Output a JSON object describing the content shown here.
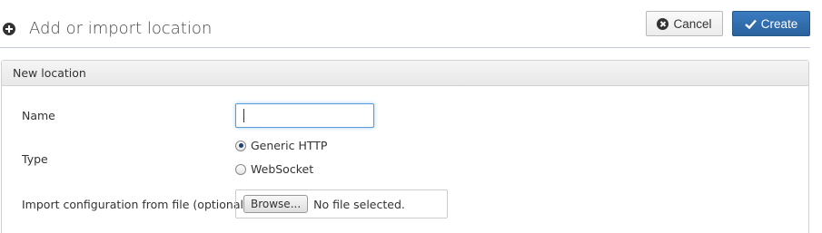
{
  "header": {
    "title": "Add or import location",
    "icon": "plus-circle-icon"
  },
  "actions": {
    "cancel_label": "Cancel",
    "create_label": "Create",
    "create_color": "#2f6aa8"
  },
  "panel": {
    "heading": "New location"
  },
  "form": {
    "name_label": "Name",
    "name_value": "",
    "type_label": "Type",
    "type_options": [
      "Generic HTTP",
      "WebSocket"
    ],
    "type_selected": "Generic HTTP",
    "import_label": "Import configuration from file (optional)",
    "browse_label": "Browse...",
    "file_status": "No file selected."
  }
}
